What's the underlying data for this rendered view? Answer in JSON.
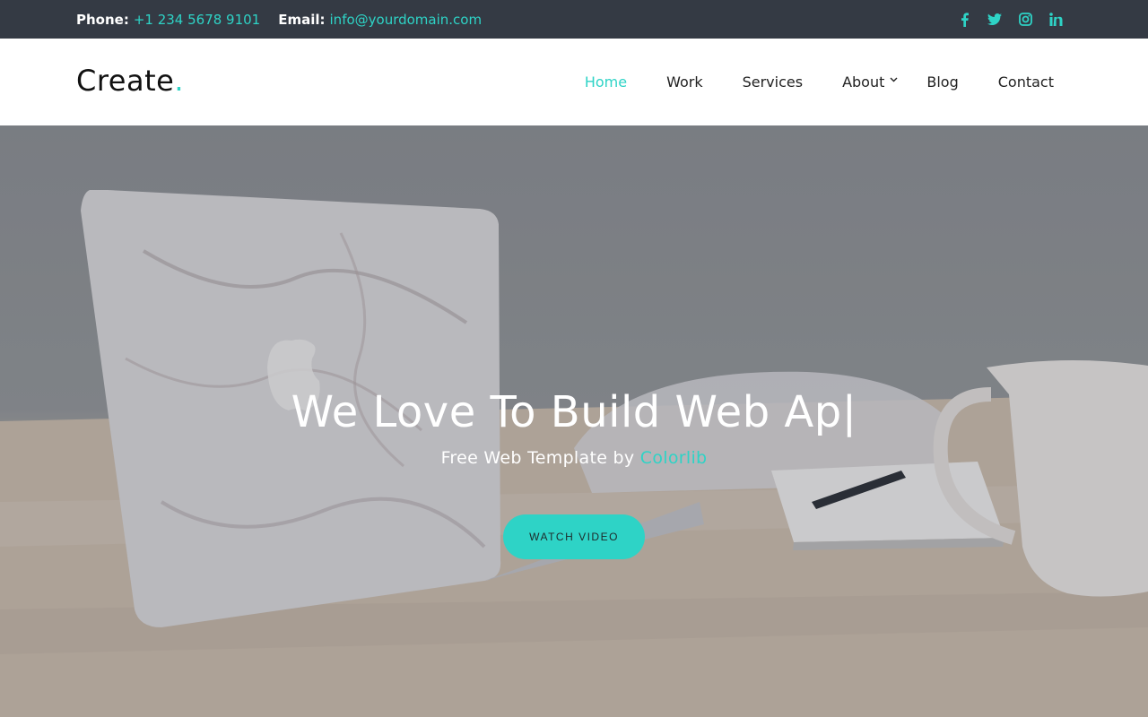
{
  "colors": {
    "accent": "#2ed3c6",
    "topbar_bg": "#343a44",
    "text_dark": "#222222"
  },
  "topbar": {
    "phone_label": "Phone:",
    "phone_value": "+1 234 5678 9101",
    "email_label": "Email:",
    "email_value": "info@yourdomain.com",
    "social": [
      "facebook-icon",
      "twitter-icon",
      "instagram-icon",
      "linkedin-icon"
    ]
  },
  "header": {
    "logo_text": "Create",
    "logo_dot": ".",
    "nav": [
      {
        "label": "Home",
        "active": true
      },
      {
        "label": "Work"
      },
      {
        "label": "Services"
      },
      {
        "label": "About",
        "has_dropdown": true
      },
      {
        "label": "Blog"
      },
      {
        "label": "Contact"
      }
    ]
  },
  "hero": {
    "title": "We Love To Build Web Ap",
    "cursor": "|",
    "subtitle_prefix": "Free Web Template by ",
    "subtitle_link": "Colorlib",
    "button_label": "WATCH VIDEO"
  }
}
